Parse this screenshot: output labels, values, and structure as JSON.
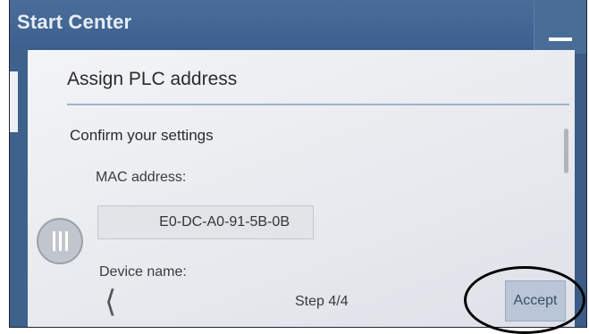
{
  "window": {
    "title": "Start Center"
  },
  "dialog": {
    "title": "Assign PLC address",
    "section_heading": "Confirm your settings",
    "mac_label": "MAC address:",
    "mac_value": "E0-DC-A0-91-5B-0B",
    "device_name_label": "Device name:",
    "step": "Step 4/4",
    "accept_label": "Accept"
  },
  "icons": {
    "minimize": "minimize-icon",
    "back": "chevron-left-icon",
    "handle": "drag-handle-icon"
  },
  "annotation": {
    "type": "hand-drawn-circle",
    "target": "accept-button",
    "color": "#000000"
  }
}
